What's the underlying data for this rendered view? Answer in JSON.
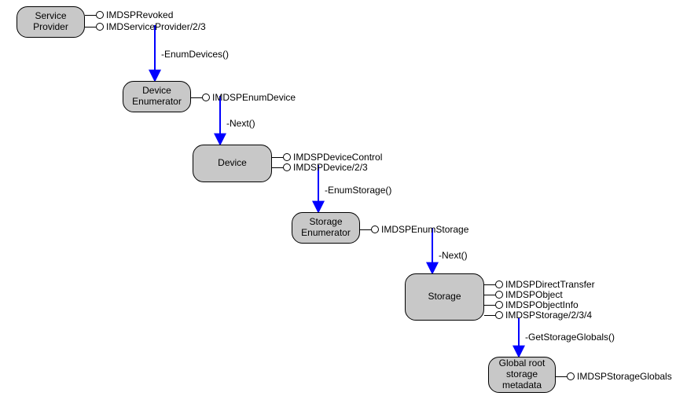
{
  "nodes": {
    "service_provider": "Service\nProvider",
    "device_enumerator": "Device\nEnumerator",
    "device": "Device",
    "storage_enumerator": "Storage\nEnumerator",
    "storage": "Storage",
    "global_root": "Global root\nstorage\nmetadata"
  },
  "interfaces": {
    "sp_revoked": "IMDSPRevoked",
    "sp_provider": "IMDServiceProvider/2/3",
    "enum_device": "IMDSPEnumDevice",
    "device_control": "IMDSPDeviceControl",
    "device_iface": "IMDSPDevice/2/3",
    "enum_storage": "IMDSPEnumStorage",
    "direct_transfer": "IMDSPDirectTransfer",
    "object": "IMDSPObject",
    "object_info": "IMDSPObjectInfo",
    "storage_iface": "IMDSPStorage/2/3/4",
    "storage_globals": "IMDSPStorageGlobals"
  },
  "methods": {
    "enum_devices": "-EnumDevices()",
    "next1": "-Next()",
    "enum_storage": "-EnumStorage()",
    "next2": "-Next()",
    "get_storage_globals": "-GetStorageGlobals()"
  }
}
